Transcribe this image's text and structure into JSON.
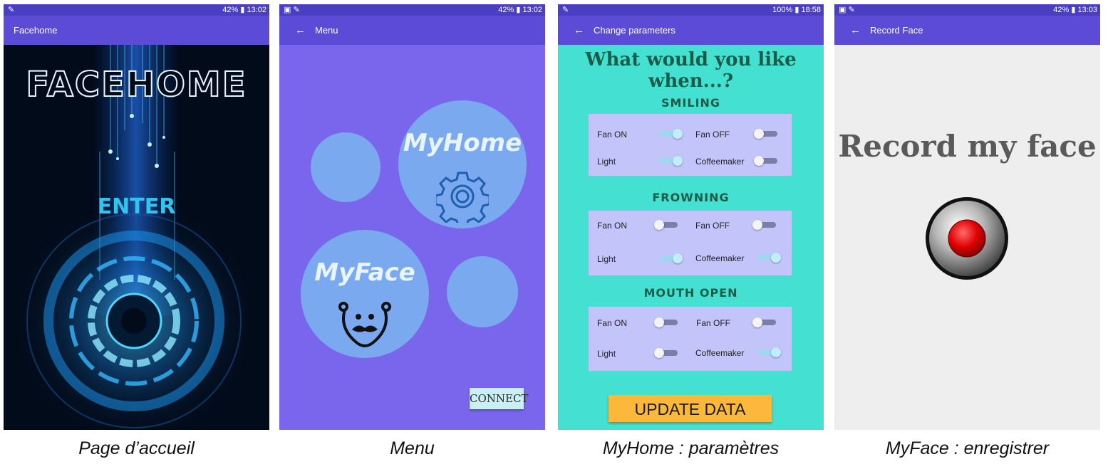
{
  "panels": [
    {
      "status": {
        "right": "42% ▮ 13:02"
      },
      "appbar": {
        "title": "Facehome"
      },
      "logo_text": "FACEHOME",
      "enter_label": "ENTER",
      "caption": "Page d’accueil"
    },
    {
      "status": {
        "right": "42% ▮ 13:02"
      },
      "appbar": {
        "title": "Menu"
      },
      "myhome_label": "MyHome",
      "myface_label": "MyFace",
      "connect_label": "CONNECT",
      "caption": "Menu"
    },
    {
      "status": {
        "right": "100% ▮ 18:58"
      },
      "appbar": {
        "title": "Change parameters"
      },
      "heading": "What would you like when...?",
      "sections": [
        {
          "title": "SMILING",
          "options": [
            {
              "label": "Fan ON",
              "on": true
            },
            {
              "label": "Fan OFF",
              "on": false
            },
            {
              "label": "Light",
              "on": true
            },
            {
              "label": "Coffeemaker",
              "on": false
            }
          ]
        },
        {
          "title": "FROWNING",
          "options": [
            {
              "label": "Fan ON",
              "on": false
            },
            {
              "label": "Fan OFF",
              "on": false
            },
            {
              "label": "Light",
              "on": true
            },
            {
              "label": "Coffeemaker",
              "on": true
            }
          ]
        },
        {
          "title": "MOUTH OPEN",
          "options": [
            {
              "label": "Fan ON",
              "on": false
            },
            {
              "label": "Fan OFF",
              "on": false
            },
            {
              "label": "Light",
              "on": false
            },
            {
              "label": "Coffeemaker",
              "on": true
            }
          ]
        }
      ],
      "update_label": "UPDATE DATA",
      "caption": "MyHome : paramètres"
    },
    {
      "status": {
        "right": "42% ▮ 13:03"
      },
      "appbar": {
        "title": "Record Face"
      },
      "title": "Record my face",
      "caption": "MyFace : enregistrer"
    }
  ],
  "colors": {
    "statusbar": "#4a3fc2",
    "appbar": "#5b4bd6",
    "menu_bg": "#7a66ec",
    "circle": "#7ba9f0",
    "params_bg": "#44e0d1",
    "card_bg": "#c3c4fa",
    "update_button": "#fbb83a",
    "record_red": "#e00000"
  },
  "icons": [
    "wifi-icon",
    "battery-icon",
    "back-arrow-icon",
    "gear-icon",
    "mustache-face-icon",
    "record-icon",
    "circuit-eye-graphic"
  ]
}
